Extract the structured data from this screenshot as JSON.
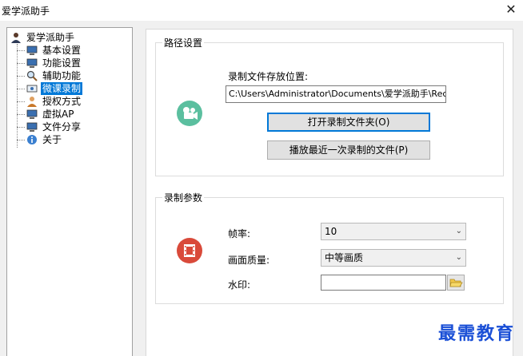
{
  "window": {
    "title": "爱学派助手",
    "close_glyph": "✕"
  },
  "tree": {
    "root": {
      "label": "爱学派助手",
      "icon": "user-icon"
    },
    "items": [
      {
        "label": "基本设置",
        "icon": "monitor-icon"
      },
      {
        "label": "功能设置",
        "icon": "monitor-icon"
      },
      {
        "label": "辅助功能",
        "icon": "magnifier-icon"
      },
      {
        "label": "微课录制",
        "icon": "screen-record-icon",
        "selected": true
      },
      {
        "label": "授权方式",
        "icon": "user-icon"
      },
      {
        "label": "虚拟AP",
        "icon": "monitor-icon"
      },
      {
        "label": "文件分享",
        "icon": "monitor-icon"
      },
      {
        "label": "关于",
        "icon": "info-icon"
      }
    ]
  },
  "path_group": {
    "title": "路径设置",
    "icon": "video-camera-icon",
    "location_label": "录制文件存放位置:",
    "location_value": "C:\\Users\\Administrator\\Documents\\爱学派助手\\Record",
    "open_folder_button": "打开录制文件夹(O)",
    "play_recent_button": "播放最近一次录制的文件(P)"
  },
  "params_group": {
    "title": "录制参数",
    "icon": "film-icon",
    "framerate_label": "帧率:",
    "framerate_value": "10",
    "quality_label": "画面质量:",
    "quality_value": "中等画质",
    "watermark_label": "水印:",
    "watermark_value": ""
  },
  "overlay": {
    "watermark_text": "最需教育"
  },
  "colors": {
    "selection": "#0078d7",
    "focus_border": "#0078d7",
    "watermark": "#1a4fd6"
  }
}
